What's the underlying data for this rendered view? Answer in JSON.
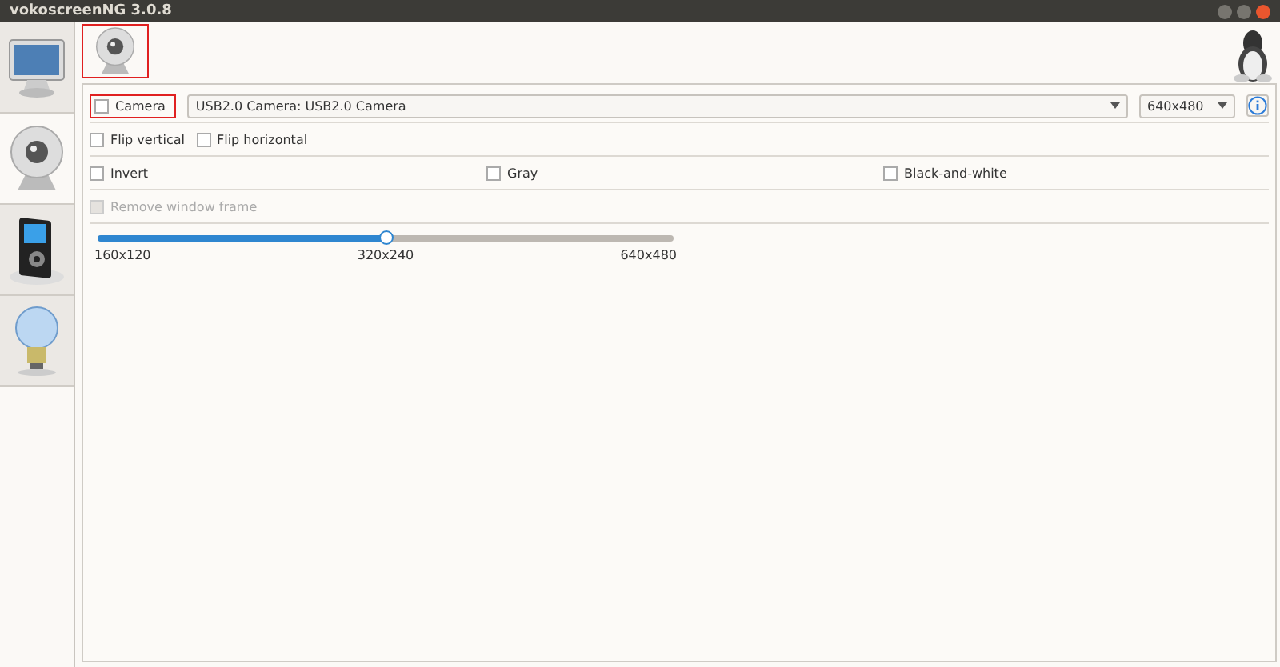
{
  "window": {
    "title": "vokoscreenNG 3.0.8"
  },
  "sidebar": {
    "items": [
      {
        "kind": "monitor",
        "selected": false
      },
      {
        "kind": "webcam",
        "selected": true
      },
      {
        "kind": "player",
        "selected": false
      },
      {
        "kind": "bulb",
        "selected": false
      }
    ]
  },
  "camera": {
    "enable": {
      "label": "Camera",
      "checked": false
    },
    "device": {
      "value": "USB2.0 Camera: USB2.0 Camera"
    },
    "resolution": {
      "value": "640x480"
    },
    "options": [
      {
        "label": "Flip vertical",
        "checked": false,
        "disabled": false
      },
      {
        "label": "Flip horizontal",
        "checked": false,
        "disabled": false
      }
    ],
    "filters": [
      {
        "label": "Invert",
        "checked": false,
        "disabled": false
      },
      {
        "label": "Gray",
        "checked": false,
        "disabled": false
      },
      {
        "label": "Black-and-white",
        "checked": false,
        "disabled": false
      }
    ],
    "frame": [
      {
        "label": "Remove window frame",
        "checked": false,
        "disabled": true
      }
    ],
    "size_slider": {
      "level": 0.5,
      "labels": [
        "160x120",
        "320x240",
        "640x480"
      ]
    }
  }
}
